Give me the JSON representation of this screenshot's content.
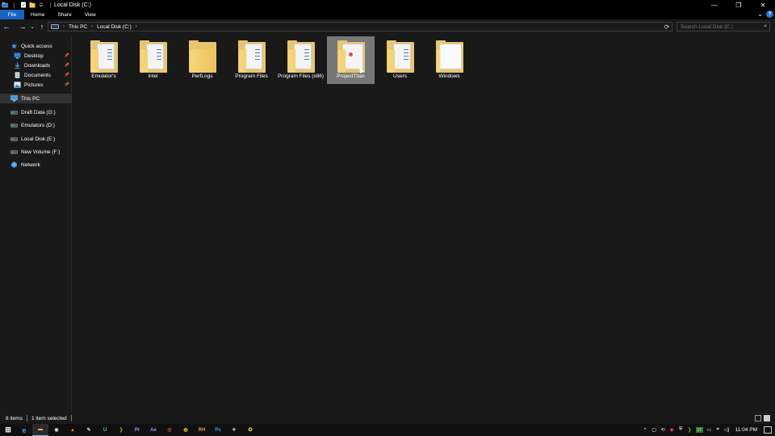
{
  "window": {
    "title": "Local Disk (C:)",
    "minimize": "—",
    "maximize": "❐",
    "close": "✕"
  },
  "ribbon": {
    "tabs": [
      "File",
      "Home",
      "Share",
      "View"
    ],
    "expand": "⌄",
    "help": "?"
  },
  "nav": {
    "back": "←",
    "forward": "→",
    "recent": "⌄",
    "up": "↑",
    "breadcrumb": [
      "This PC",
      "Local Disk (C:)"
    ],
    "refresh": "⟳",
    "search_placeholder": "Search Local Disk (C:)"
  },
  "navpane": {
    "items": [
      {
        "label": "Quick access",
        "icon": "star-icon"
      },
      {
        "label": "Desktop",
        "icon": "desktop-icon",
        "pinned": true
      },
      {
        "label": "Downloads",
        "icon": "download-icon",
        "pinned": true
      },
      {
        "label": "Documents",
        "icon": "documents-icon",
        "pinned": true
      },
      {
        "label": "Pictures",
        "icon": "pictures-icon",
        "pinned": true
      },
      {
        "label": "This PC",
        "icon": "computer-icon",
        "selected": true
      },
      {
        "label": "Draft Data (G:)",
        "icon": "drive-icon"
      },
      {
        "label": "Emulators (D:)",
        "icon": "drive-icon"
      },
      {
        "label": "Local Disk (E:)",
        "icon": "drive-icon"
      },
      {
        "label": "New Volume (F:)",
        "icon": "drive-icon"
      },
      {
        "label": "Network",
        "icon": "network-icon"
      }
    ]
  },
  "folders": [
    {
      "name": "Emulator's",
      "selected": false
    },
    {
      "name": "Intel",
      "selected": false
    },
    {
      "name": "PerfLogs",
      "selected": false
    },
    {
      "name": "Program Files",
      "selected": false
    },
    {
      "name": "Program Files (x86)",
      "selected": false
    },
    {
      "name": "ProjectTitan",
      "selected": true
    },
    {
      "name": "Users",
      "selected": false
    },
    {
      "name": "Windows",
      "selected": false
    }
  ],
  "status": {
    "count": "8 items",
    "selected": "1 item selected"
  },
  "taskbar": {
    "apps": [
      {
        "name": "windows-start-icon",
        "glyph": "⊞",
        "color": "#ffffff"
      },
      {
        "name": "edge-icon",
        "glyph": "e",
        "color": "#3aa0e8"
      },
      {
        "name": "file-explorer-icon",
        "glyph": "▬",
        "color": "#f2c94c"
      },
      {
        "name": "steam-icon",
        "glyph": "◉",
        "color": "#c7d5e0"
      },
      {
        "name": "vlc-icon",
        "glyph": "▲",
        "color": "#f08a24"
      },
      {
        "name": "tool-icon",
        "glyph": "✎",
        "color": "#d0d0d0"
      },
      {
        "name": "ubisoft-icon",
        "glyph": "U",
        "color": "#3ddc84"
      },
      {
        "name": "nvidia-icon",
        "glyph": "❯",
        "color": "#76b900"
      },
      {
        "name": "premiere-icon",
        "glyph": "Pr",
        "color": "#9999ff"
      },
      {
        "name": "after-effects-icon",
        "glyph": "Ae",
        "color": "#9999ff"
      },
      {
        "name": "app-icon",
        "glyph": "◎",
        "color": "#e74c3c"
      },
      {
        "name": "chrome-icon",
        "glyph": "◍",
        "color": "#f4c20d"
      },
      {
        "name": "rh-icon",
        "glyph": "RH",
        "color": "#e0a030"
      },
      {
        "name": "photoshop-icon",
        "glyph": "Ps",
        "color": "#31a8ff"
      },
      {
        "name": "plane-icon",
        "glyph": "✈",
        "color": "#e0e0e0"
      },
      {
        "name": "game-icon",
        "glyph": "✪",
        "color": "#f2c94c"
      }
    ],
    "tray": {
      "chevron": "^",
      "badge": "17",
      "time": "11:04 PM"
    }
  }
}
